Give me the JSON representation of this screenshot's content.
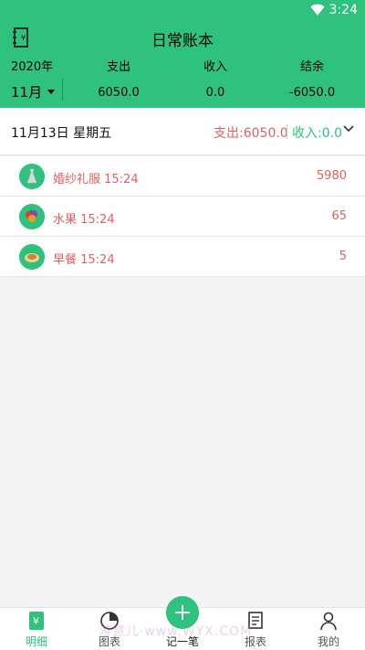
{
  "status_bar": {
    "time": "3:24"
  },
  "app": {
    "title": "日常账本"
  },
  "summary": {
    "year": "2020年",
    "month": "11月",
    "expense_label": "支出",
    "expense_value": "6050.0",
    "income_label": "收入",
    "income_value": "0.0",
    "balance_label": "结余",
    "balance_value": "-6050.0"
  },
  "day": {
    "date": "11月13日 星期五",
    "expense": "支出:6050.0",
    "income": "收入:0.0"
  },
  "entries": [
    {
      "name": "婚纱礼服 15:24",
      "amount": "5980",
      "icon": "dress-icon"
    },
    {
      "name": "水果 15:24",
      "amount": "65",
      "icon": "fruit-icon"
    },
    {
      "name": "早餐 15:24",
      "amount": "5",
      "icon": "breakfast-icon"
    }
  ],
  "tabs": {
    "detail": "明细",
    "chart": "图表",
    "add": "记一笔",
    "report": "报表",
    "mine": "我的"
  },
  "watermark": "ㅤ游意儿·www.WYX.COM",
  "colors": {
    "accent": "#2ec27e",
    "expense": "#e06060"
  }
}
